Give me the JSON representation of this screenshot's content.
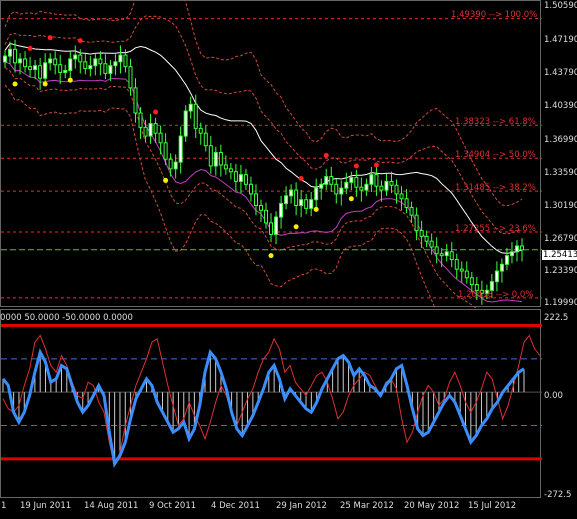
{
  "price_axis": {
    "ticks": [
      "1.50590",
      "1.47190",
      "1.43790",
      "1.40390",
      "1.36990",
      "1.33590",
      "1.30190",
      "1.26790",
      "1.23390",
      "1.19990"
    ],
    "current": "1.25413"
  },
  "fib_levels": [
    {
      "label": "1.49390 --> 100.0%",
      "price": 1.4939
    },
    {
      "label": "1.38323 --> 61.8%",
      "price": 1.38323
    },
    {
      "label": "1.34904 --> 50.0%",
      "price": 1.34904
    },
    {
      "label": "1.31485 --> 38.2%",
      "price": 1.31485
    },
    {
      "label": "1.27255 --> 23.6%",
      "price": 1.27255
    },
    {
      "label": "1.20418 --> 0.0%",
      "price": 1.20418
    }
  ],
  "indicator": {
    "label": "0000 50.0000 -50.0000 0.0000",
    "ticks": [
      "222.5",
      "0.00",
      "-272.5"
    ]
  },
  "time_axis": [
    "1",
    "19 Jun 2011",
    "14 Aug 2011",
    "9 Oct 2011",
    "4 Dec 2011",
    "29 Jan 2012",
    "25 Mar 2012",
    "20 May 2012",
    "15 Jul 2012"
  ],
  "colors": {
    "background": "#000000",
    "bull_candle": "#ffffff",
    "bear_candle": "#000000",
    "wick": "#3cff3c",
    "fib": "#e03030",
    "bollinger": "#d24a3a",
    "ma_fast": "#ffffff",
    "ma_slow": "#c040c0",
    "cci_thick": "#3a8eff",
    "cci_thin": "#e03030"
  },
  "chart_data": [
    {
      "type": "candlestick",
      "title": "",
      "ylim": [
        1.1999,
        1.5059
      ],
      "current_price": 1.25413,
      "close_series": [
        1.455,
        1.462,
        1.448,
        1.452,
        1.444,
        1.441,
        1.445,
        1.432,
        1.448,
        1.452,
        1.446,
        1.438,
        1.44,
        1.452,
        1.456,
        1.449,
        1.442,
        1.445,
        1.452,
        1.447,
        1.437,
        1.445,
        1.449,
        1.456,
        1.444,
        1.422,
        1.396,
        1.381,
        1.372,
        1.385,
        1.375,
        1.365,
        1.348,
        1.338,
        1.345,
        1.372,
        1.398,
        1.405,
        1.38,
        1.375,
        1.362,
        1.341,
        1.355,
        1.342,
        1.338,
        1.335,
        1.325,
        1.332,
        1.322,
        1.312,
        1.3,
        1.295,
        1.282,
        1.27,
        1.288,
        1.302,
        1.31,
        1.316,
        1.3,
        1.306,
        1.297,
        1.306,
        1.318,
        1.322,
        1.33,
        1.322,
        1.312,
        1.318,
        1.324,
        1.329,
        1.319,
        1.316,
        1.322,
        1.332,
        1.32,
        1.316,
        1.325,
        1.321,
        1.312,
        1.307,
        1.298,
        1.29,
        1.274,
        1.268,
        1.263,
        1.257,
        1.25,
        1.248,
        1.252,
        1.244,
        1.234,
        1.232,
        1.225,
        1.218,
        1.212,
        1.209,
        1.212,
        1.221,
        1.232,
        1.239,
        1.248,
        1.252,
        1.258,
        1.254
      ]
    },
    {
      "type": "line",
      "title": "",
      "ylim": [
        -272.5,
        222.5
      ],
      "levels": [
        -100,
        0,
        100
      ],
      "series": [
        {
          "values": [
            40,
            20,
            -60,
            -90,
            -60,
            -10,
            60,
            120,
            90,
            30,
            40,
            80,
            70,
            20,
            -30,
            -60,
            -40,
            -10,
            20,
            -10,
            -120,
            -215,
            -190,
            -150,
            -80,
            -20,
            10,
            40,
            20,
            -30,
            -60,
            -90,
            -120,
            -110,
            -90,
            -140,
            -110,
            -40,
            60,
            120,
            100,
            60,
            10,
            -60,
            -110,
            -130,
            -100,
            -70,
            -30,
            10,
            60,
            80,
            40,
            -20,
            10,
            -10,
            -30,
            -50,
            -60,
            -30,
            10,
            40,
            70,
            100,
            110,
            90,
            50,
            70,
            50,
            20,
            10,
            -10,
            20,
            40,
            70,
            80,
            20,
            -50,
            -110,
            -130,
            -120,
            -90,
            -60,
            -30,
            -10,
            -30,
            -70,
            -110,
            -150,
            -130,
            -100,
            -80,
            -50,
            -30,
            0,
            20,
            40,
            60,
            70
          ]
        },
        {
          "values": [
            -20,
            -50,
            -60,
            -40,
            20,
            70,
            150,
            170,
            130,
            80,
            60,
            110,
            80,
            30,
            -10,
            -20,
            30,
            20,
            -30,
            -60,
            -150,
            -220,
            -180,
            -100,
            -40,
            20,
            60,
            100,
            150,
            160,
            90,
            20,
            -40,
            -100,
            -80,
            -30,
            -70,
            -100,
            -140,
            -90,
            -30,
            20,
            -10,
            -60,
            -100,
            -60,
            -20,
            10,
            60,
            100,
            120,
            160,
            130,
            60,
            80,
            30,
            10,
            -10,
            20,
            50,
            60,
            30,
            -20,
            -80,
            -60,
            -10,
            20,
            40,
            60,
            50,
            20,
            -10,
            30,
            40,
            10,
            -80,
            -150,
            -120,
            -60,
            -10,
            20,
            0,
            -40,
            -20,
            30,
            60,
            20,
            -30,
            -60,
            -30,
            10,
            60,
            40,
            -20,
            -80,
            -40,
            20,
            80,
            150,
            170,
            130,
            110
          ]
        }
      ]
    }
  ]
}
